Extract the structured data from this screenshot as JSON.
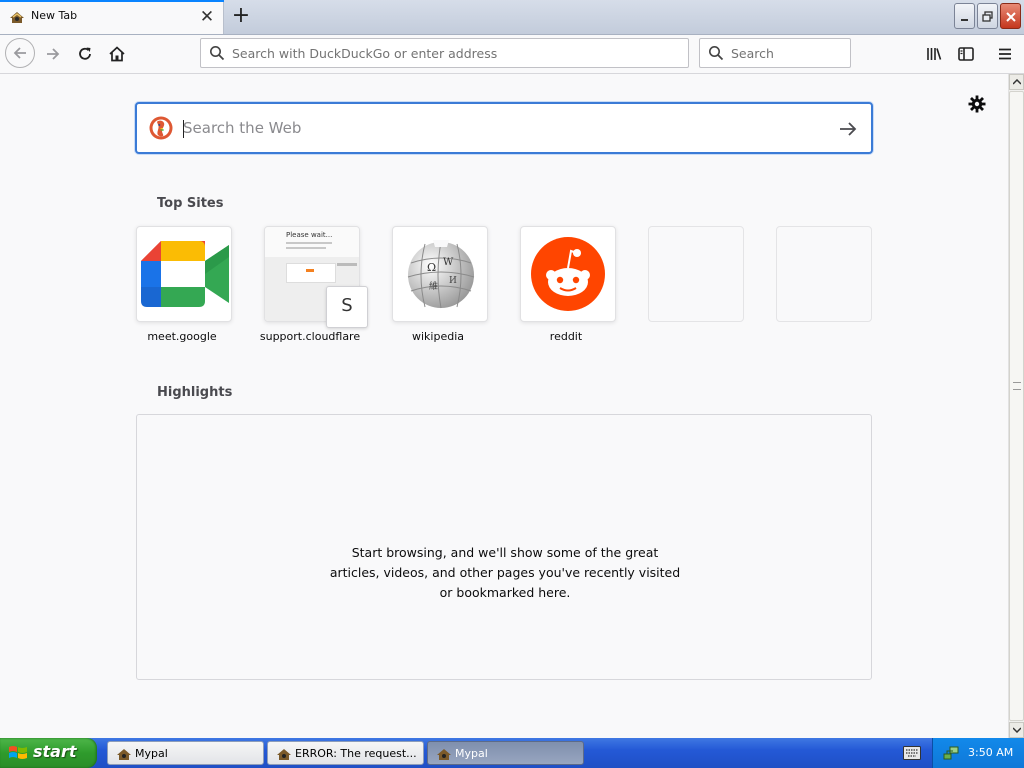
{
  "browser": {
    "tab": {
      "title": "New Tab"
    },
    "urlbar": {
      "placeholder": "Search with DuckDuckGo or enter address"
    },
    "searchbar": {
      "placeholder": "Search"
    }
  },
  "newtab": {
    "websearch": {
      "placeholder": "Search the Web"
    },
    "top_sites": {
      "title": "Top Sites",
      "tiles": [
        {
          "label": "meet.google",
          "icon": "google-meet-icon"
        },
        {
          "label": "support.cloudflare",
          "icon": "cloudflare-screenshot",
          "preview_title": "Please wait...",
          "badge": "S"
        },
        {
          "label": "wikipedia",
          "icon": "wikipedia-globe-icon"
        },
        {
          "label": "reddit",
          "icon": "reddit-icon"
        },
        {
          "label": "",
          "icon": "empty-tile"
        },
        {
          "label": "",
          "icon": "empty-tile"
        }
      ]
    },
    "highlights": {
      "title": "Highlights",
      "message": "Start browsing, and we'll show some of the great articles, videos, and other pages you've recently visited or bookmarked here."
    }
  },
  "taskbar": {
    "start_label": "start",
    "tasks": [
      {
        "label": "Mypal",
        "active": false
      },
      {
        "label": "ERROR: The request...",
        "active": false
      },
      {
        "label": "Mypal",
        "active": true
      }
    ],
    "clock": "3:50 AM"
  },
  "colors": {
    "accent": "#0a84ff",
    "search_focus": "#3b7bd6",
    "reddit": "#ff4500",
    "ddg": "#de5833",
    "taskbar": "#245edb",
    "start": "#3c9d37"
  }
}
